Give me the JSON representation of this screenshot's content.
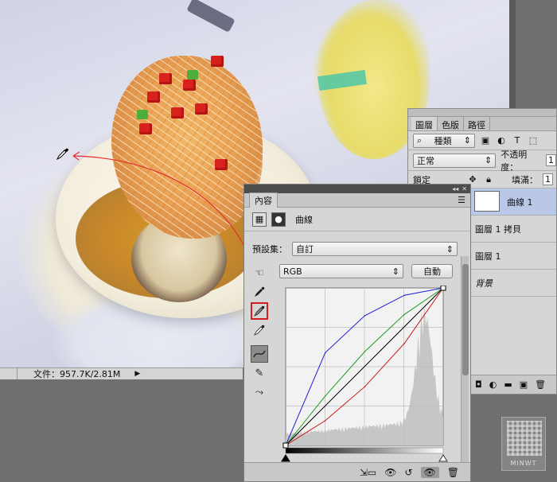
{
  "status": {
    "doc_info": "文件：957.7K/2.81M",
    "arrow": "▶"
  },
  "layers_panel": {
    "tabs": [
      "圖層",
      "色版",
      "路徑"
    ],
    "filter_kind": "種類",
    "blend_mode": "正常",
    "opacity_label": "不透明度：",
    "opacity_value": "1",
    "lock_label": "鎖定",
    "fill_label": "填滿：",
    "fill_value": "1",
    "layers": [
      {
        "name": "曲線 1",
        "selected": true
      },
      {
        "name": "圖層 1 拷貝",
        "selected": false
      },
      {
        "name": "圖層 1",
        "selected": false
      },
      {
        "name": "背景",
        "selected": false
      }
    ]
  },
  "properties_panel": {
    "tab_label": "內容",
    "adjustment_name": "曲線",
    "preset_label": "預設集：",
    "preset_value": "自訂",
    "channel_value": "RGB",
    "auto_button": "自動"
  },
  "chart_data": {
    "type": "line",
    "title": "",
    "xlabel": "",
    "ylabel": "",
    "xlim": [
      0,
      255
    ],
    "ylim": [
      0,
      255
    ],
    "series": [
      {
        "name": "",
        "color": "#1f1fd0",
        "x": [
          0,
          64,
          128,
          192,
          255
        ],
        "y": [
          0,
          150,
          210,
          243,
          255
        ]
      },
      {
        "name": "",
        "color": "#1f9a1f",
        "x": [
          0,
          64,
          128,
          192,
          255
        ],
        "y": [
          0,
          80,
          152,
          212,
          255
        ]
      },
      {
        "name": "",
        "color": "#000000",
        "x": [
          0,
          255
        ],
        "y": [
          0,
          255
        ]
      },
      {
        "name": "",
        "color": "#c81e1e",
        "x": [
          0,
          64,
          128,
          192,
          255
        ],
        "y": [
          0,
          40,
          95,
          165,
          255
        ]
      }
    ]
  },
  "watermark": {
    "text": "MINWT"
  }
}
